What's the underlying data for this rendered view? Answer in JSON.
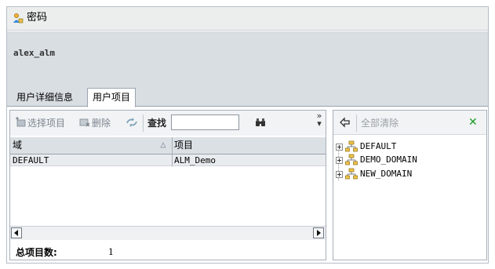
{
  "window": {
    "title": "密码"
  },
  "user": {
    "name": "alex_alm"
  },
  "tabs": [
    {
      "label": "用户详细信息"
    },
    {
      "label": "用户项目"
    }
  ],
  "toolbar": {
    "select_project": "选择项目",
    "delete": "删除",
    "find_label": "查找",
    "find_value": ""
  },
  "grid": {
    "columns": [
      "域",
      "项目"
    ],
    "rows": [
      {
        "domain": "DEFAULT",
        "project": "ALM_Demo"
      }
    ]
  },
  "footer": {
    "total_label": "总项目数:",
    "total_value": "1"
  },
  "right_panel": {
    "clear_all": "全部清除",
    "tree": [
      {
        "label": "DEFAULT"
      },
      {
        "label": "DEMO_DOMAIN"
      },
      {
        "label": "NEW_DOMAIN"
      }
    ]
  },
  "colors": {
    "band": "#d9dee3",
    "close_green": "#1c9a24",
    "disabled_text": "#7d8690"
  }
}
